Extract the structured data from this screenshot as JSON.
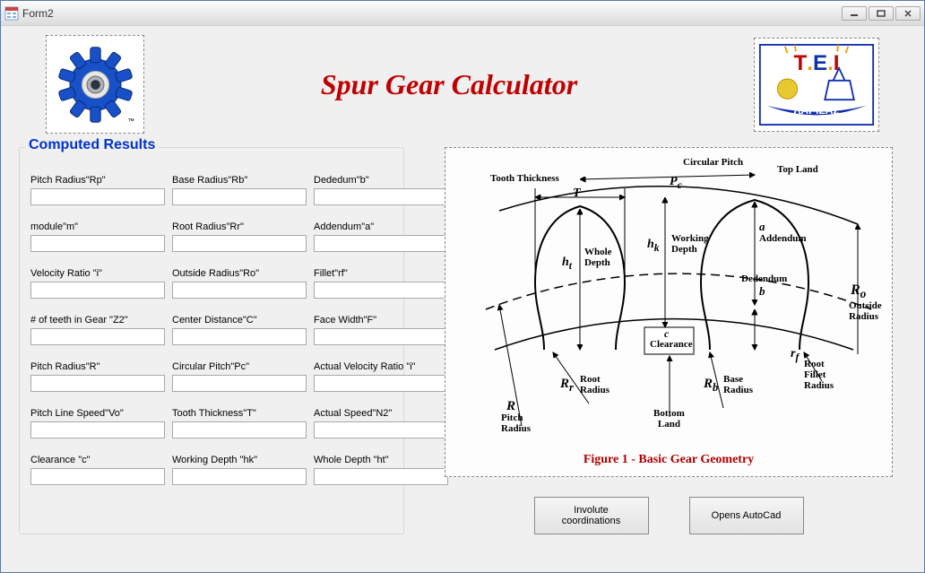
{
  "window": {
    "title": "Form2"
  },
  "header": {
    "app_title": "Spur Gear Calculator"
  },
  "results": {
    "group_title": "Computed Results",
    "fields": [
      {
        "label": "Pitch Radius\"Rp\"",
        "value": ""
      },
      {
        "label": "Base Radius\"Rb\"",
        "value": ""
      },
      {
        "label": "Dededum\"b\"",
        "value": ""
      },
      {
        "label": "module\"m\"",
        "value": ""
      },
      {
        "label": "Root Radius\"Rr\"",
        "value": ""
      },
      {
        "label": "Addendum\"a\"",
        "value": ""
      },
      {
        "label": "Velocity Ratio \"i\"",
        "value": ""
      },
      {
        "label": "Outside Radius\"Ro\"",
        "value": ""
      },
      {
        "label": "Fillet\"rf\"",
        "value": ""
      },
      {
        "label": "# of teeth in Gear \"Z2\"",
        "value": ""
      },
      {
        "label": "Center Distance\"C\"",
        "value": ""
      },
      {
        "label": "Face Width\"F\"",
        "value": ""
      },
      {
        "label": "Pitch Radius\"R\"",
        "value": ""
      },
      {
        "label": "Circular Pitch\"Pc\"",
        "value": ""
      },
      {
        "label": "Actual Velocity Ratio \"i\"",
        "value": ""
      },
      {
        "label": "Pitch Line Speed\"Vo\"",
        "value": ""
      },
      {
        "label": "Tooth Thickness\"T\"",
        "value": ""
      },
      {
        "label": "Actual Speed\"N2\"",
        "value": ""
      },
      {
        "label": "Clearance \"c\"",
        "value": ""
      },
      {
        "label": "Working Depth \"hk\"",
        "value": ""
      },
      {
        "label": "Whole Depth \"ht\"",
        "value": ""
      }
    ]
  },
  "diagram": {
    "caption": "Figure 1 -  Basic Gear Geometry",
    "labels": {
      "tooth_thickness": "Tooth Thickness",
      "T": "T",
      "circular_pitch": "Circular Pitch",
      "Pc": "P",
      "Pc_sub": "c",
      "top_land": "Top Land",
      "whole_depth": "Whole\nDepth",
      "ht": "h",
      "ht_sub": "t",
      "working_depth": "Working\nDepth",
      "hk": "h",
      "hk_sub": "k",
      "addendum": "Addendum",
      "a": "a",
      "dedendum": "Dedendum",
      "b": "b",
      "clearance": "Clearance",
      "c": "c",
      "root_radius": "Root\nRadius",
      "Rr": "R",
      "Rr_sub": "r",
      "base_radius": "Base\nRadius",
      "Rb": "R",
      "Rb_sub": "b",
      "root_fillet_radius": "Root\nFillet\nRadius",
      "rf": "r",
      "rf_sub": "f",
      "outside_radius": "Outside\nRadius",
      "Ro": "R",
      "Ro_sub": "o",
      "pitch_radius": "Pitch\nRadius",
      "R": "R",
      "bottom_land": "Bottom\nLand"
    }
  },
  "buttons": {
    "involute": "Involute\ncoordinations",
    "autocad": "Opens AutoCad"
  }
}
